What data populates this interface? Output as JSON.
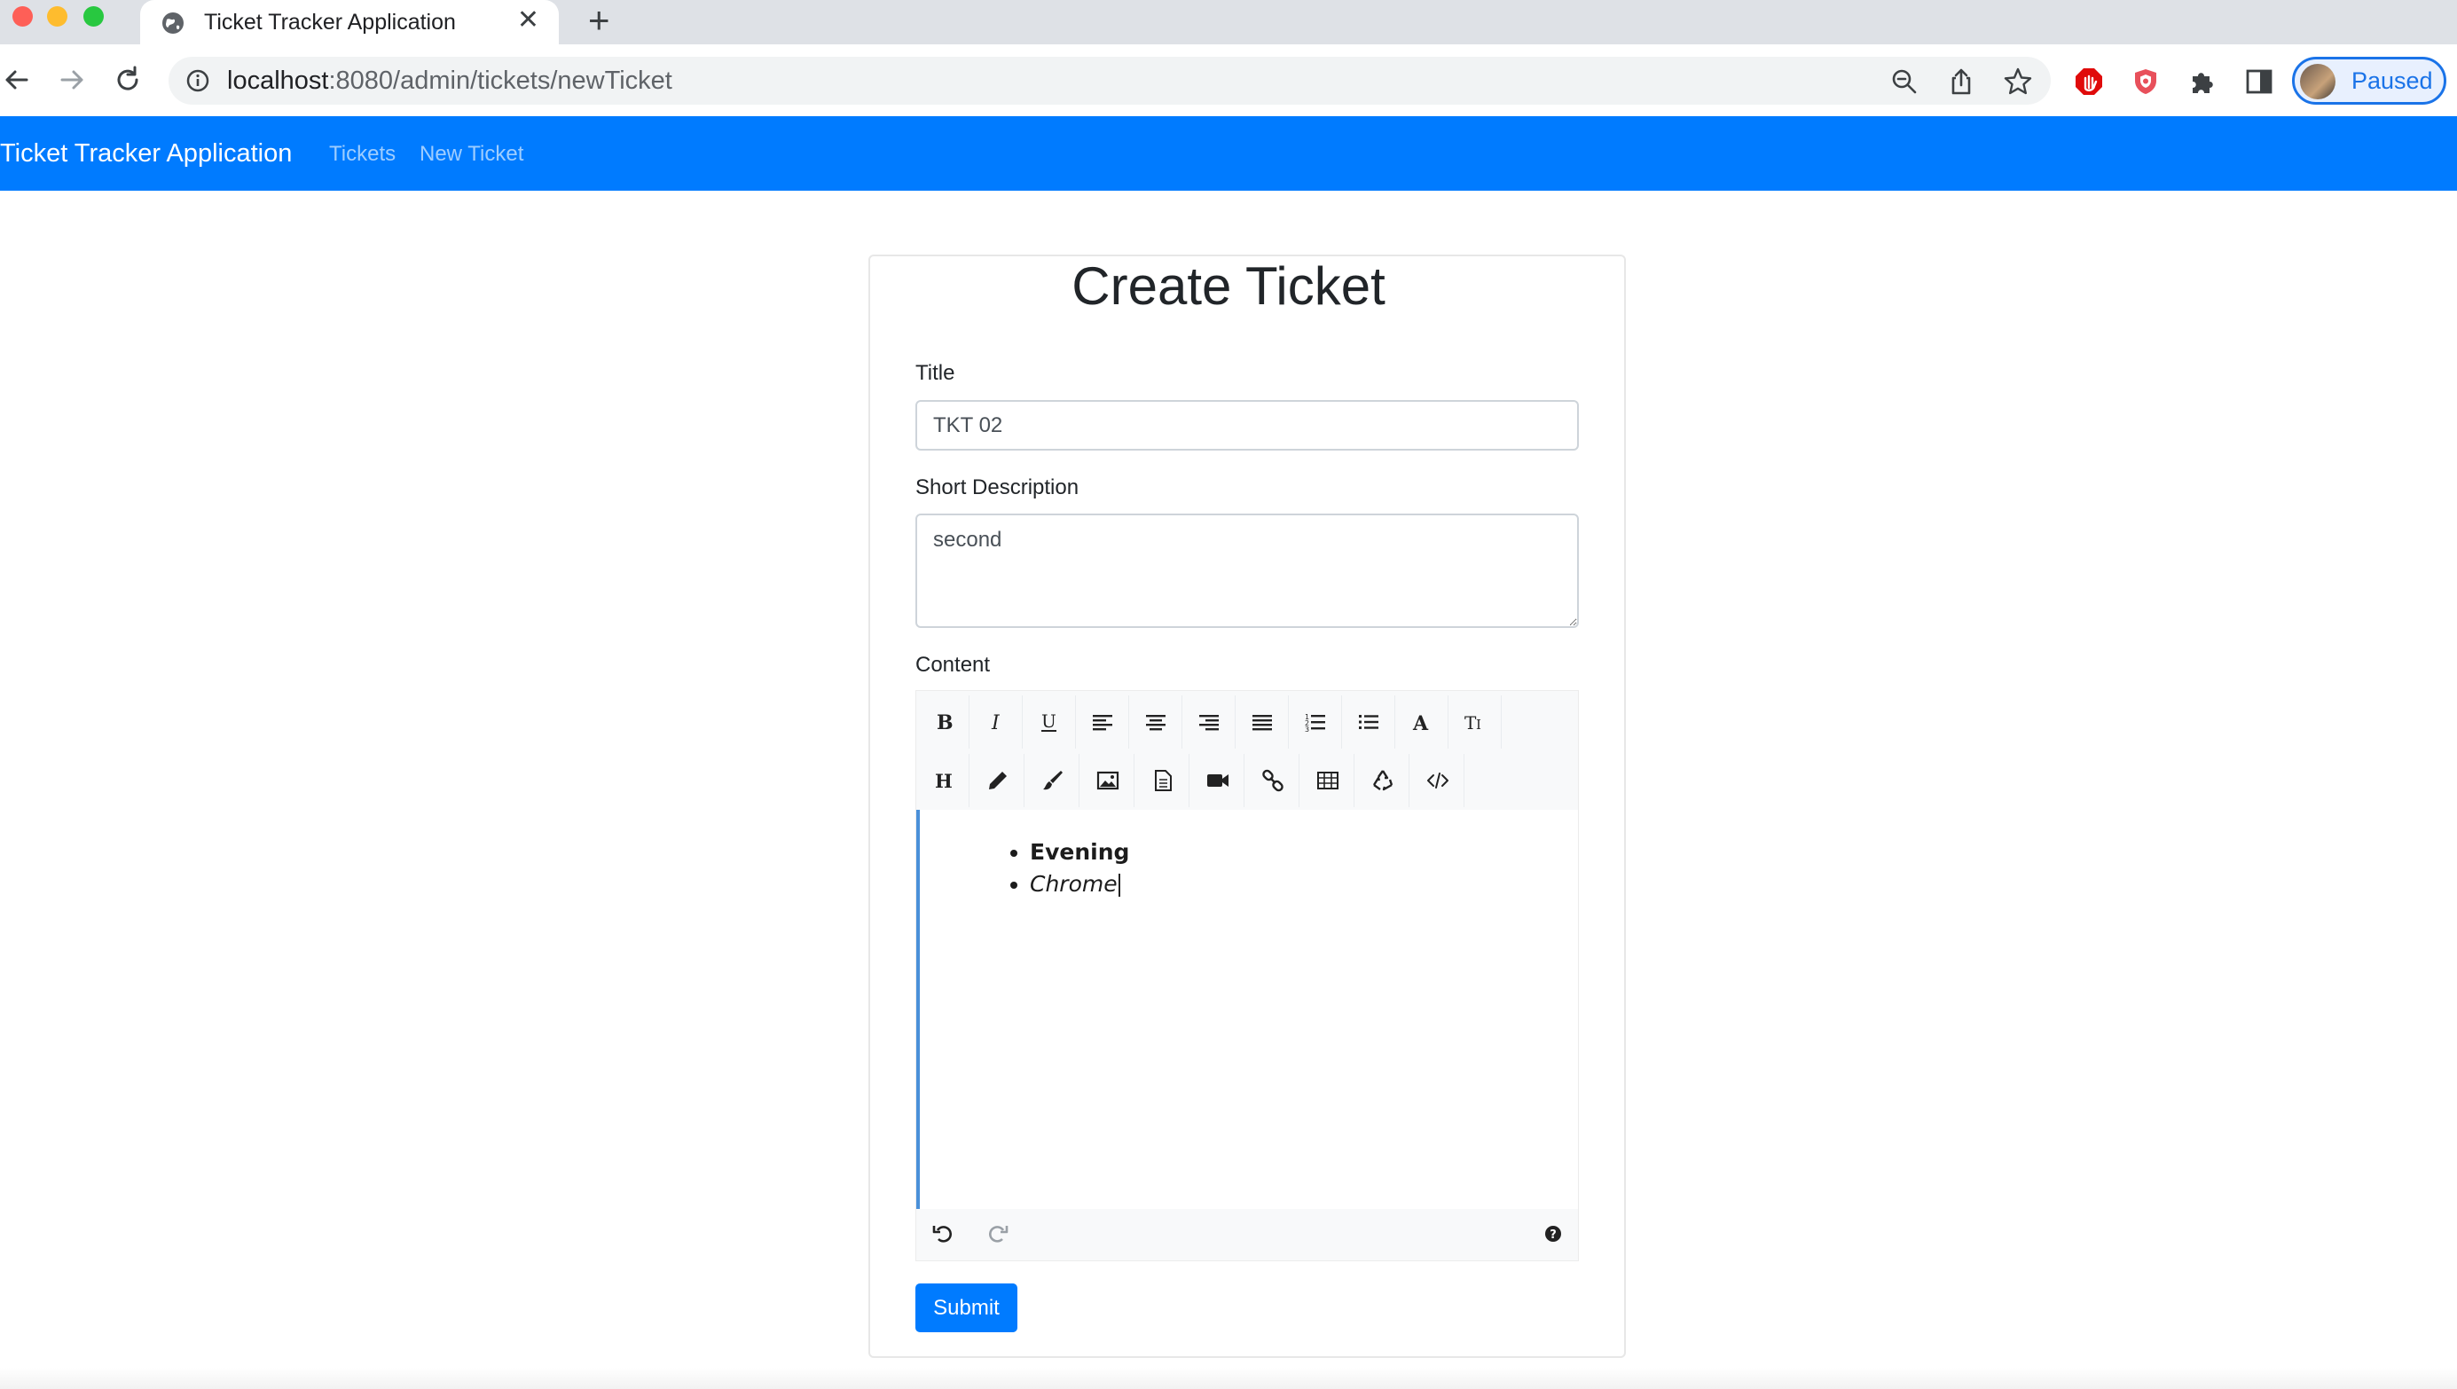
{
  "browser": {
    "tab_title": "Ticket Tracker Application",
    "new_tab_glyph": "+",
    "tab_close_glyph": "✕",
    "url_host": "localhost",
    "url_path": ":8080/admin/tickets/newTicket",
    "profile_label": "Paused",
    "accent_color": "#1a73e8"
  },
  "navbar": {
    "brand": "Ticket Tracker Application",
    "links": [
      "Tickets",
      "New Ticket"
    ],
    "background": "#007bff"
  },
  "form": {
    "heading": "Create Ticket",
    "title_label": "Title",
    "title_value": "TKT 02",
    "description_label": "Short Description",
    "description_value": "second",
    "content_label": "Content",
    "submit_label": "Submit"
  },
  "editor": {
    "toolbar_row1": [
      "bold-icon",
      "italic-icon",
      "underline-icon",
      "align-left-icon",
      "align-center-icon",
      "align-right-icon",
      "align-justify-icon",
      "ordered-list-icon",
      "unordered-list-icon",
      "font-color-icon",
      "text-size-icon"
    ],
    "toolbar_row2": [
      "heading-icon",
      "pencil-icon",
      "brush-icon",
      "image-icon",
      "file-icon",
      "video-icon",
      "link-icon",
      "table-icon",
      "recycle-icon",
      "code-view-icon"
    ],
    "content_items": [
      {
        "text": "Evening",
        "style": "bold"
      },
      {
        "text": "Chrome",
        "style": "italic"
      }
    ],
    "footer_icons": [
      "undo-icon",
      "redo-icon",
      "help-icon"
    ]
  }
}
